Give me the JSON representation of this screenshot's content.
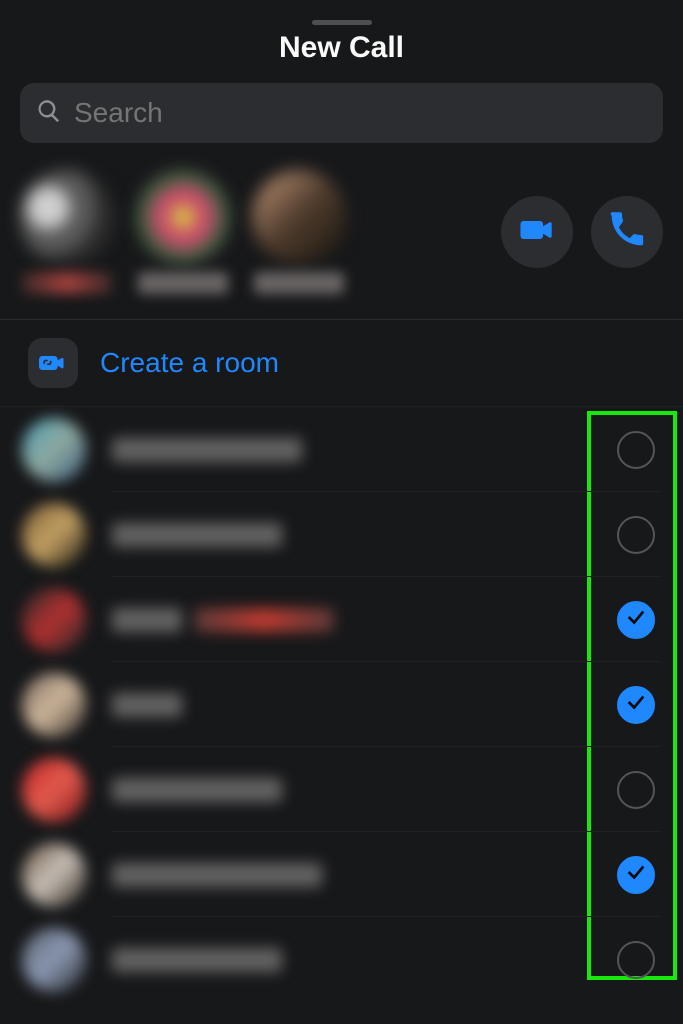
{
  "background": {
    "left_text": "",
    "right_time": ""
  },
  "title": "New Call",
  "search": {
    "placeholder": "Search",
    "value": ""
  },
  "selected_participants": [
    {
      "name": ""
    },
    {
      "name": ""
    },
    {
      "name": ""
    }
  ],
  "actions": {
    "video_call": "Video call",
    "audio_call": "Audio call"
  },
  "create_room_label": "Create a room",
  "contacts": [
    {
      "name": "",
      "selected": false
    },
    {
      "name": "",
      "selected": false
    },
    {
      "name": "",
      "selected": true
    },
    {
      "name": "",
      "selected": true
    },
    {
      "name": "",
      "selected": false
    },
    {
      "name": "",
      "selected": true
    },
    {
      "name": "",
      "selected": false
    }
  ],
  "accent": "#1f88ff",
  "highlight_box_present": true
}
